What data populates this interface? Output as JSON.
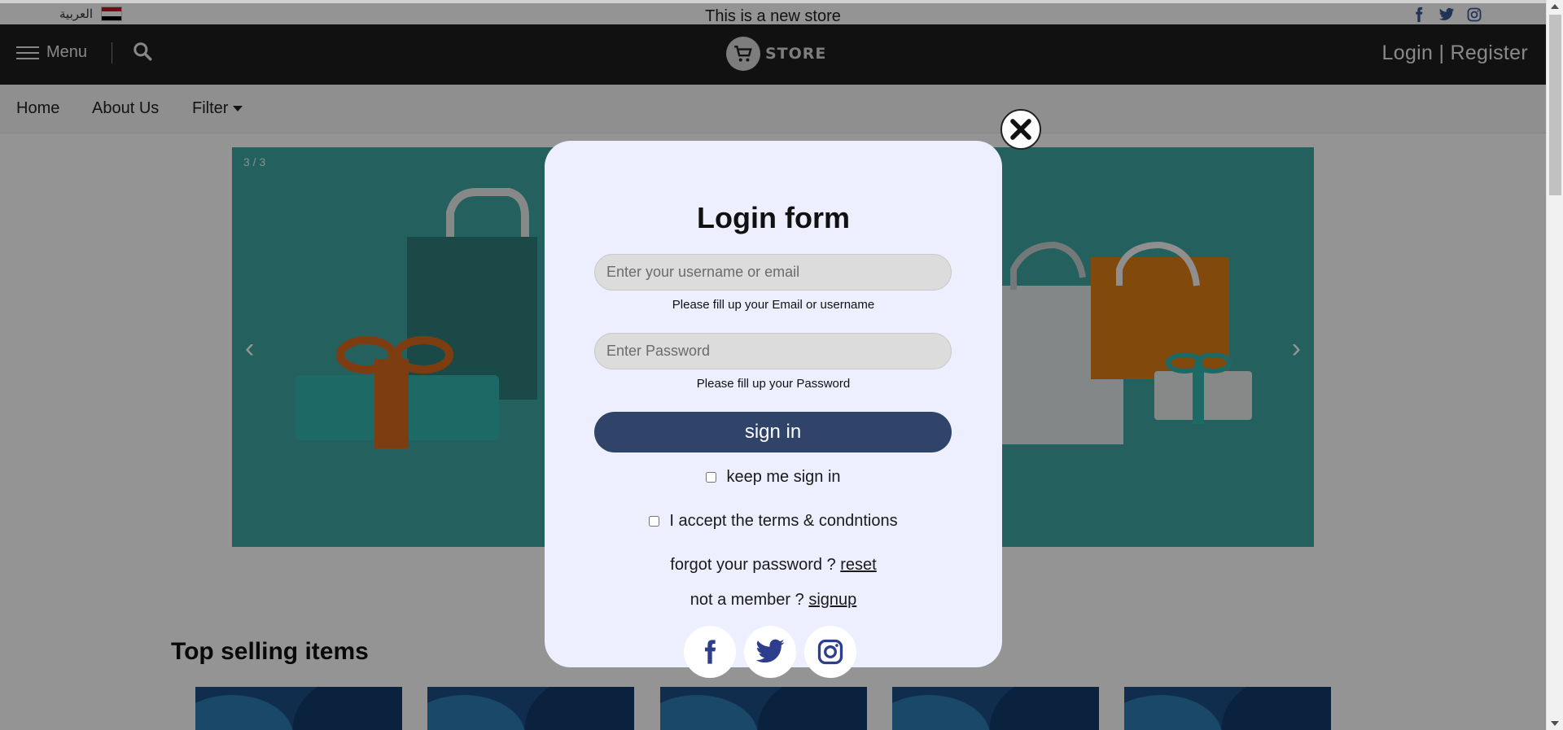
{
  "topbar": {
    "language_label": "العربية",
    "announcement": "This is a new store",
    "social_icons": [
      "facebook-icon",
      "twitter-icon",
      "instagram-icon"
    ]
  },
  "header": {
    "menu_label": "Menu",
    "logo_text": "STORE",
    "auth_links": "Login | Register"
  },
  "nav": {
    "items": [
      {
        "label": "Home"
      },
      {
        "label": "About Us"
      },
      {
        "label": "Filter"
      }
    ]
  },
  "carousel": {
    "counter": "3 / 3",
    "prev": "‹",
    "next": "›"
  },
  "top_selling": {
    "title": "Top selling items"
  },
  "login_modal": {
    "title": "Login form",
    "username_placeholder": "Enter your username or email",
    "username_hint": "Please fill up your Email or username",
    "password_placeholder": "Enter Password",
    "password_hint": "Please fill up your Password",
    "signin_label": "sign in",
    "keep_signed_in_label": "keep me sign in",
    "terms_label": "I accept the terms & condntions",
    "forgot_text": "forgot your password ?",
    "reset_link": "reset",
    "member_text": "not a member ?",
    "signup_link": "signup",
    "social_icons": [
      "facebook-icon",
      "twitter-icon",
      "instagram-icon"
    ]
  },
  "colors": {
    "header_bg": "#1e1e1e",
    "hero_bg": "#3fa7a3",
    "modal_bg": "#eeeffe",
    "signin_bg": "#2f4468",
    "social_blue": "#2c3e8c",
    "brand_blue": "#3b5998"
  }
}
